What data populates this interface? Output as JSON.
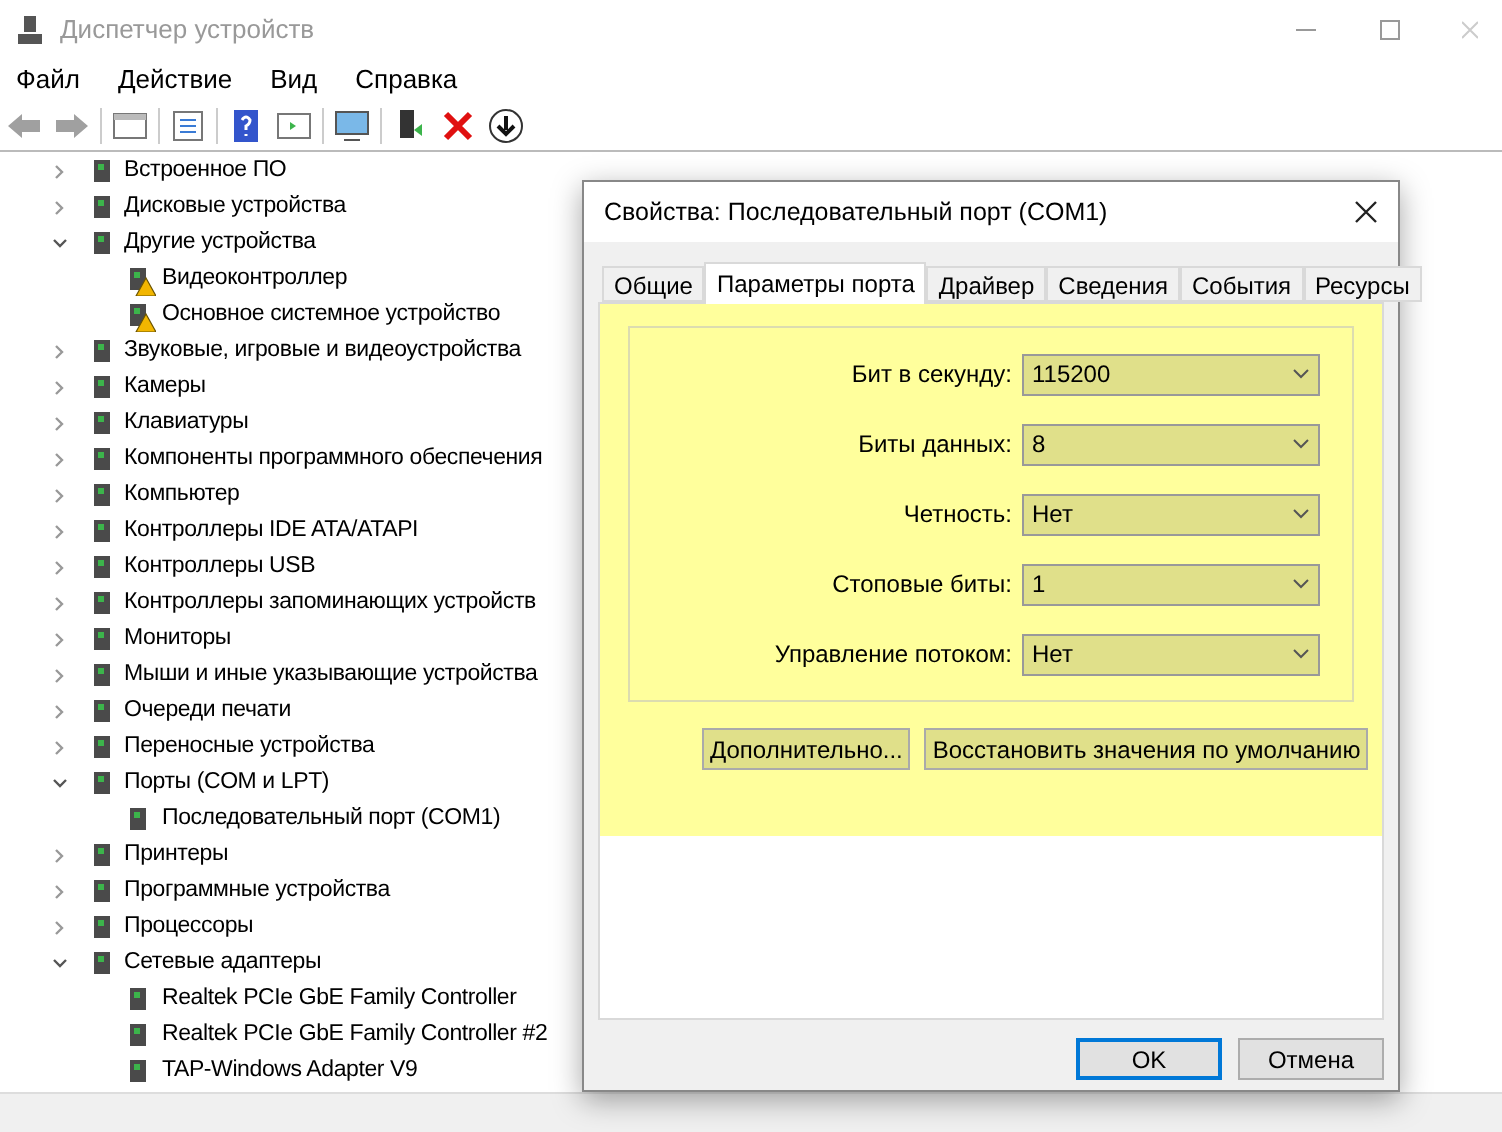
{
  "window": {
    "title": "Диспетчер устройств"
  },
  "menu": [
    "Файл",
    "Действие",
    "Вид",
    "Справка"
  ],
  "tree": [
    {
      "label": "Встроенное ПО",
      "expanded": false
    },
    {
      "label": "Дисковые устройства",
      "expanded": false
    },
    {
      "label": "Другие устройства",
      "expanded": true,
      "children": [
        {
          "label": "Видеоконтроллер",
          "warning": true
        },
        {
          "label": "Основное системное устройство",
          "warning": true
        }
      ]
    },
    {
      "label": "Звуковые, игровые и видеоустройства",
      "expanded": false
    },
    {
      "label": "Камеры",
      "expanded": false
    },
    {
      "label": "Клавиатуры",
      "expanded": false
    },
    {
      "label": "Компоненты программного обеспечения",
      "expanded": false
    },
    {
      "label": "Компьютер",
      "expanded": false
    },
    {
      "label": "Контроллеры IDE ATA/ATAPI",
      "expanded": false
    },
    {
      "label": "Контроллеры USB",
      "expanded": false
    },
    {
      "label": "Контроллеры запоминающих устройств",
      "expanded": false
    },
    {
      "label": "Мониторы",
      "expanded": false
    },
    {
      "label": "Мыши и иные указывающие устройства",
      "expanded": false
    },
    {
      "label": "Очереди печати",
      "expanded": false
    },
    {
      "label": "Переносные устройства",
      "expanded": false
    },
    {
      "label": "Порты (COM и LPT)",
      "expanded": true,
      "children": [
        {
          "label": "Последовательный порт (COM1)",
          "warning": false
        }
      ]
    },
    {
      "label": "Принтеры",
      "expanded": false
    },
    {
      "label": "Программные устройства",
      "expanded": false
    },
    {
      "label": "Процессоры",
      "expanded": false
    },
    {
      "label": "Сетевые адаптеры",
      "expanded": true,
      "children": [
        {
          "label": "Realtek PCIe GbE Family Controller",
          "warning": false
        },
        {
          "label": "Realtek PCIe GbE Family Controller #2",
          "warning": false
        },
        {
          "label": "TAP-Windows Adapter V9",
          "warning": false
        }
      ]
    }
  ],
  "dialog": {
    "title": "Свойства: Последовательный порт (COM1)",
    "tabs": [
      {
        "label": "Общие",
        "selected": false
      },
      {
        "label": "Параметры порта",
        "selected": true
      },
      {
        "label": "Драйвер",
        "selected": false
      },
      {
        "label": "Сведения",
        "selected": false
      },
      {
        "label": "События",
        "selected": false
      },
      {
        "label": "Ресурсы",
        "selected": false
      }
    ],
    "highlighted": true,
    "settings": [
      {
        "label": "Бит в секунду:",
        "value": "115200"
      },
      {
        "label": "Биты данных:",
        "value": "8"
      },
      {
        "label": "Четность:",
        "value": "Нет"
      },
      {
        "label": "Стоповые биты:",
        "value": "1"
      },
      {
        "label": "Управление потоком:",
        "value": "Нет"
      }
    ],
    "panel_buttons": [
      "Дополнительно...",
      "Восстановить значения по умолчанию"
    ],
    "ok_button": "OK",
    "cancel_button": "Отмена"
  }
}
